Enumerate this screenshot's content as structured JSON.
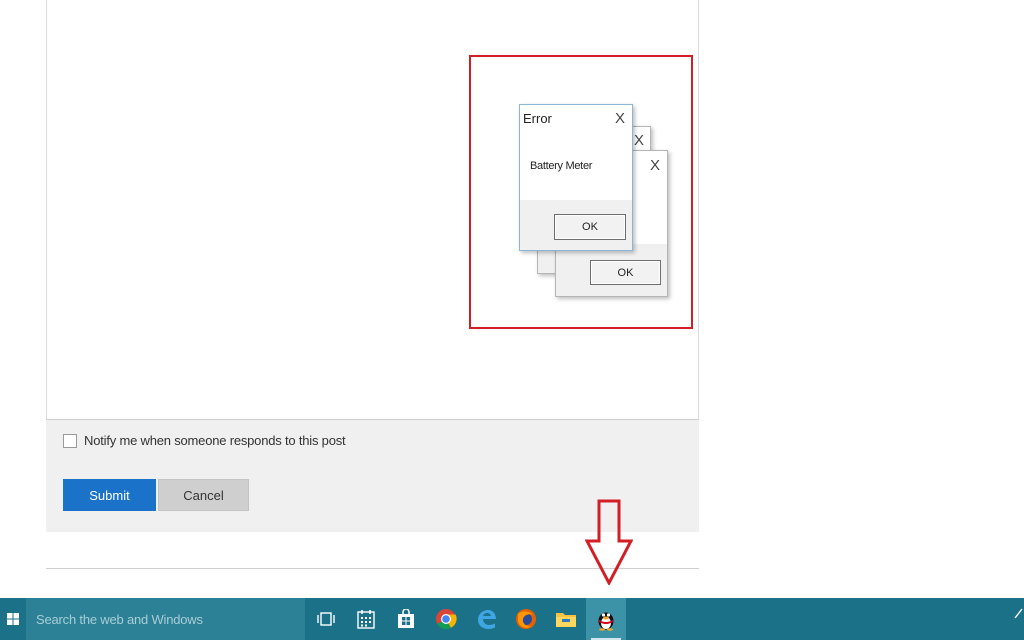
{
  "post_form": {
    "notify_label": "Notify me when someone responds to this post",
    "notify_checked": false,
    "submit_label": "Submit",
    "cancel_label": "Cancel"
  },
  "dialogs": {
    "front": {
      "title": "Error",
      "message": "Battery Meter",
      "ok_label": "OK",
      "close_glyph": "X"
    },
    "back1": {
      "ok_label": "OK",
      "close_glyph": "X"
    },
    "back2": {
      "close_glyph": "X"
    }
  },
  "taskbar": {
    "search_placeholder": "Search the web and Windows",
    "icons": [
      "task-view-icon",
      "calendar-icon",
      "store-icon",
      "chrome-icon",
      "edge-icon",
      "firefox-icon",
      "file-explorer-icon",
      "qq-penguin-icon"
    ],
    "active_icon": "qq-penguin-icon",
    "background": "#1b7187"
  },
  "annotation": {
    "highlight_color": "#d21f26",
    "arrow_color": "#d21f26"
  }
}
